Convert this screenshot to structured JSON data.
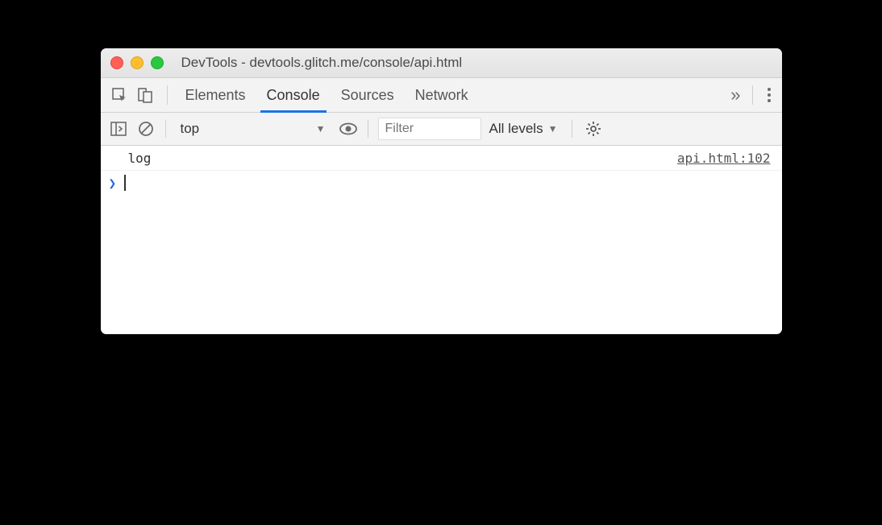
{
  "window": {
    "title": "DevTools - devtools.glitch.me/console/api.html"
  },
  "tabs": {
    "elements": "Elements",
    "console": "Console",
    "sources": "Sources",
    "network": "Network"
  },
  "subbar": {
    "context_selected": "top",
    "filter_placeholder": "Filter",
    "levels_label": "All levels"
  },
  "console": {
    "entries": [
      {
        "message": "log",
        "source": "api.html:102"
      }
    ]
  }
}
